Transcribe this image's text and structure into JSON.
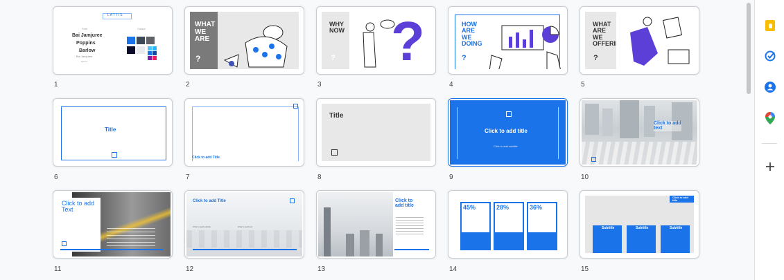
{
  "slides": [
    {
      "num": "1",
      "logo": "LATTIS",
      "font_hdr": "Font",
      "colour_hdr": "Colour",
      "fonts": [
        "Bai Jamjuree",
        "Poppins",
        "Barlow"
      ],
      "font_sub": "Bai Jamjuree",
      "font_sub2": "Barlow"
    },
    {
      "num": "2",
      "title": "WHAT\nWE\nARE",
      "q": "?"
    },
    {
      "num": "3",
      "title": "WHY\nNOW",
      "q": "?"
    },
    {
      "num": "4",
      "title": "HOW\nARE\nWE\nDOING",
      "q": "?"
    },
    {
      "num": "5",
      "title": "WHAT\nARE\nWE\nOFFERING",
      "q": "?"
    },
    {
      "num": "6",
      "title": "Title"
    },
    {
      "num": "7",
      "title": "Click to add Title"
    },
    {
      "num": "8",
      "title": "Title"
    },
    {
      "num": "9",
      "title": "Click to add title",
      "subtitle": "Click to add subtitle"
    },
    {
      "num": "10",
      "title": "Click to add\ntext"
    },
    {
      "num": "11",
      "title": "Click to add\nText"
    },
    {
      "num": "12",
      "title": "Click to add Title",
      "sub1": "Click to add subtitle",
      "sub2": "Click to add text"
    },
    {
      "num": "13",
      "title": "Click to\nadd title"
    },
    {
      "num": "14",
      "stats": [
        "45%",
        "28%",
        "36%"
      ]
    },
    {
      "num": "15",
      "tag": "Click to add title",
      "subtitles": [
        "Subtitle",
        "Subtitle",
        "Subtitle"
      ]
    }
  ],
  "sidebar": [
    {
      "name": "keep-icon",
      "color": "#fbbc04"
    },
    {
      "name": "tasks-icon",
      "color": "#1a73e8"
    },
    {
      "name": "contacts-icon",
      "color": "#1a73e8"
    },
    {
      "name": "maps-icon",
      "color": "#34a853"
    },
    {
      "name": "add-icon",
      "color": "#444"
    }
  ]
}
